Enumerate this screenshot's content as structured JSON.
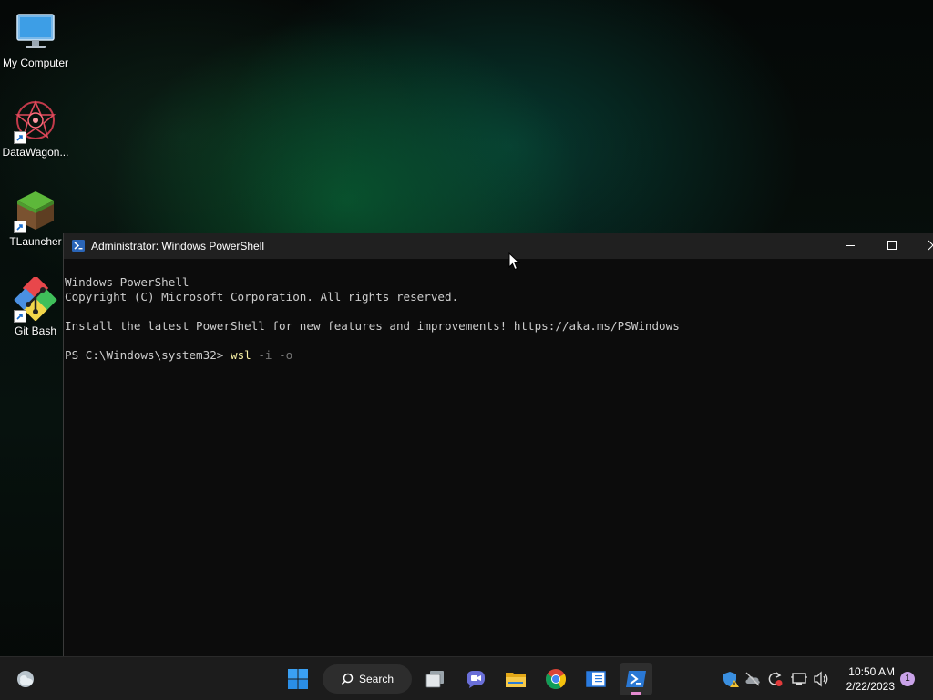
{
  "desktop": {
    "icons": [
      {
        "label": "My Computer"
      },
      {
        "label": "DataWagon..."
      },
      {
        "label": "TLauncher"
      },
      {
        "label": "Git Bash"
      }
    ]
  },
  "window": {
    "title": "Administrator: Windows PowerShell",
    "lines": [
      "Windows PowerShell",
      "Copyright (C) Microsoft Corporation. All rights reserved.",
      "",
      "Install the latest PowerShell for new features and improvements! https://aka.ms/PSWindows",
      ""
    ],
    "prompt": {
      "path": "PS C:\\Windows\\system32> ",
      "command": "wsl",
      "args": " -i -o"
    }
  },
  "taskbar": {
    "search_label": "Search",
    "pinned": [
      "widgets-icon",
      "start-icon",
      "task-view-icon",
      "chat-icon",
      "file-explorer-icon",
      "chrome-icon",
      "notepad-icon",
      "powershell-icon"
    ],
    "clock": {
      "time": "10:50 AM",
      "date": "2/22/2023"
    },
    "notification_count": "1"
  },
  "colors": {
    "terminal_bg": "#0c0c0c",
    "terminal_text": "#cccccc",
    "command_color": "#f9f1a5",
    "arg_color": "#767676",
    "taskbar_bg": "#1c1c1c"
  }
}
